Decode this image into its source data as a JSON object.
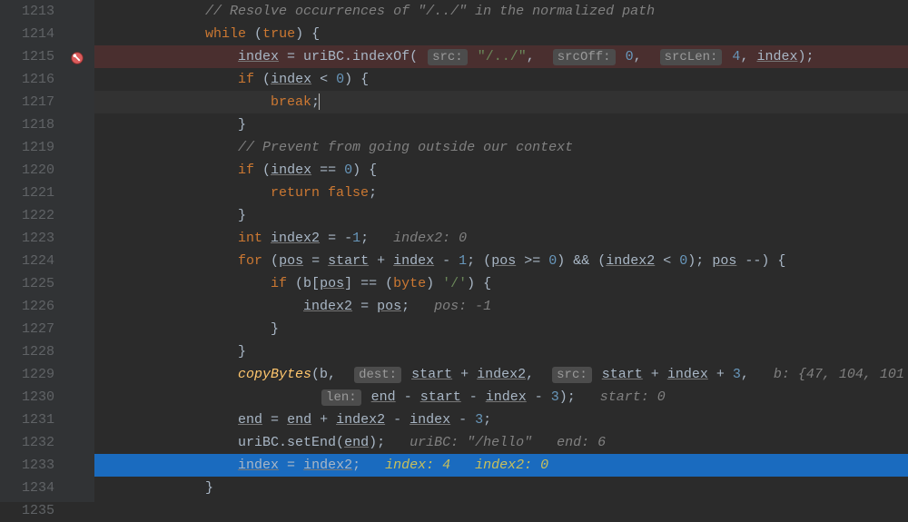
{
  "lineStart": 1213,
  "lines": [
    {
      "num": "1213",
      "cls": "",
      "indent": "            ",
      "tokens": [
        {
          "t": "// Resolve occurrences of \"/../\" in the normalized path",
          "c": "cmt"
        }
      ]
    },
    {
      "num": "1214",
      "cls": "",
      "indent": "            ",
      "tokens": [
        {
          "t": "while",
          "c": "kw"
        },
        {
          "t": " ("
        },
        {
          "t": "true",
          "c": "kw"
        },
        {
          "t": ") {"
        }
      ]
    },
    {
      "num": "1215",
      "cls": "hl-red",
      "indent": "                ",
      "tokens": [
        {
          "t": "index",
          "c": "var"
        },
        {
          "t": " = uriBC.indexOf( "
        },
        {
          "t": "src:",
          "c": "hint-box"
        },
        {
          "t": " "
        },
        {
          "t": "\"/../\"",
          "c": "str"
        },
        {
          "t": ",  "
        },
        {
          "t": "srcOff:",
          "c": "hint-box"
        },
        {
          "t": " "
        },
        {
          "t": "0",
          "c": "num"
        },
        {
          "t": ",  "
        },
        {
          "t": "srcLen:",
          "c": "hint-box"
        },
        {
          "t": " "
        },
        {
          "t": "4",
          "c": "num"
        },
        {
          "t": ", "
        },
        {
          "t": "index",
          "c": "var"
        },
        {
          "t": ");"
        }
      ]
    },
    {
      "num": "1216",
      "cls": "",
      "indent": "                ",
      "tokens": [
        {
          "t": "if",
          "c": "kw"
        },
        {
          "t": " ("
        },
        {
          "t": "index",
          "c": "var"
        },
        {
          "t": " < "
        },
        {
          "t": "0",
          "c": "num"
        },
        {
          "t": ") {"
        }
      ]
    },
    {
      "num": "1217",
      "cls": "hl-dark",
      "indent": "                    ",
      "tokens": [
        {
          "t": "break",
          "c": "kw"
        },
        {
          "t": ";"
        },
        {
          "t": "",
          "caret": true
        }
      ]
    },
    {
      "num": "1218",
      "cls": "",
      "indent": "                ",
      "tokens": [
        {
          "t": "}"
        }
      ]
    },
    {
      "num": "1219",
      "cls": "",
      "indent": "                ",
      "tokens": [
        {
          "t": "// Prevent from going outside our context",
          "c": "cmt"
        }
      ]
    },
    {
      "num": "1220",
      "cls": "",
      "indent": "                ",
      "tokens": [
        {
          "t": "if",
          "c": "kw"
        },
        {
          "t": " ("
        },
        {
          "t": "index",
          "c": "var"
        },
        {
          "t": " == "
        },
        {
          "t": "0",
          "c": "num"
        },
        {
          "t": ") {"
        }
      ]
    },
    {
      "num": "1221",
      "cls": "",
      "indent": "                    ",
      "tokens": [
        {
          "t": "return false",
          "c": "kw"
        },
        {
          "t": ";"
        }
      ]
    },
    {
      "num": "1222",
      "cls": "",
      "indent": "                ",
      "tokens": [
        {
          "t": "}"
        }
      ]
    },
    {
      "num": "1223",
      "cls": "",
      "indent": "                ",
      "tokens": [
        {
          "t": "int ",
          "c": "kw"
        },
        {
          "t": "index2",
          "c": "var"
        },
        {
          "t": " = -"
        },
        {
          "t": "1",
          "c": "num"
        },
        {
          "t": ";   "
        },
        {
          "t": "index2: 0",
          "c": "hint"
        }
      ]
    },
    {
      "num": "1224",
      "cls": "",
      "indent": "                ",
      "tokens": [
        {
          "t": "for",
          "c": "kw"
        },
        {
          "t": " ("
        },
        {
          "t": "pos",
          "c": "var"
        },
        {
          "t": " = "
        },
        {
          "t": "start",
          "c": "var"
        },
        {
          "t": " + "
        },
        {
          "t": "index",
          "c": "var"
        },
        {
          "t": " - "
        },
        {
          "t": "1",
          "c": "num"
        },
        {
          "t": "; ("
        },
        {
          "t": "pos",
          "c": "var"
        },
        {
          "t": " >= "
        },
        {
          "t": "0",
          "c": "num"
        },
        {
          "t": ") && ("
        },
        {
          "t": "index2",
          "c": "var"
        },
        {
          "t": " < "
        },
        {
          "t": "0",
          "c": "num"
        },
        {
          "t": "); "
        },
        {
          "t": "pos",
          "c": "var"
        },
        {
          "t": " --) {"
        }
      ]
    },
    {
      "num": "1225",
      "cls": "",
      "indent": "                    ",
      "tokens": [
        {
          "t": "if",
          "c": "kw"
        },
        {
          "t": " (b["
        },
        {
          "t": "pos",
          "c": "var"
        },
        {
          "t": "] == ("
        },
        {
          "t": "byte",
          "c": "kw"
        },
        {
          "t": ") "
        },
        {
          "t": "'/'",
          "c": "str"
        },
        {
          "t": ") {"
        }
      ]
    },
    {
      "num": "1226",
      "cls": "",
      "indent": "                        ",
      "tokens": [
        {
          "t": "index2",
          "c": "var"
        },
        {
          "t": " = "
        },
        {
          "t": "pos",
          "c": "var"
        },
        {
          "t": ";   "
        },
        {
          "t": "pos: -1",
          "c": "hint"
        }
      ]
    },
    {
      "num": "1227",
      "cls": "",
      "indent": "                    ",
      "tokens": [
        {
          "t": "}"
        }
      ]
    },
    {
      "num": "1228",
      "cls": "",
      "indent": "                ",
      "tokens": [
        {
          "t": "}"
        }
      ]
    },
    {
      "num": "1229",
      "cls": "",
      "indent": "                ",
      "tokens": [
        {
          "t": "copyBytes",
          "c": "fn"
        },
        {
          "t": "(b,  "
        },
        {
          "t": "dest:",
          "c": "hint-box"
        },
        {
          "t": " "
        },
        {
          "t": "start",
          "c": "var"
        },
        {
          "t": " + "
        },
        {
          "t": "index2",
          "c": "var"
        },
        {
          "t": ",  "
        },
        {
          "t": "src:",
          "c": "hint-box"
        },
        {
          "t": " "
        },
        {
          "t": "start",
          "c": "var"
        },
        {
          "t": " + "
        },
        {
          "t": "index",
          "c": "var"
        },
        {
          "t": " + "
        },
        {
          "t": "3",
          "c": "num"
        },
        {
          "t": ",   "
        },
        {
          "t": "b: {47, 104, 101",
          "c": "hint"
        }
      ]
    },
    {
      "num": "1230",
      "cls": "",
      "indent": "                          ",
      "tokens": [
        {
          "t": "len:",
          "c": "hint-box"
        },
        {
          "t": " "
        },
        {
          "t": "end",
          "c": "var"
        },
        {
          "t": " - "
        },
        {
          "t": "start",
          "c": "var"
        },
        {
          "t": " - "
        },
        {
          "t": "index",
          "c": "var"
        },
        {
          "t": " - "
        },
        {
          "t": "3",
          "c": "num"
        },
        {
          "t": ");   "
        },
        {
          "t": "start: 0",
          "c": "hint"
        }
      ]
    },
    {
      "num": "1231",
      "cls": "",
      "indent": "                ",
      "tokens": [
        {
          "t": "end",
          "c": "var"
        },
        {
          "t": " = "
        },
        {
          "t": "end",
          "c": "var"
        },
        {
          "t": " + "
        },
        {
          "t": "index2",
          "c": "var"
        },
        {
          "t": " - "
        },
        {
          "t": "index",
          "c": "var"
        },
        {
          "t": " - "
        },
        {
          "t": "3",
          "c": "num"
        },
        {
          "t": ";"
        }
      ]
    },
    {
      "num": "1232",
      "cls": "",
      "indent": "                ",
      "tokens": [
        {
          "t": "uriBC.setEnd("
        },
        {
          "t": "end",
          "c": "var"
        },
        {
          "t": ");   "
        },
        {
          "t": "uriBC: \"/hello\"   end: 6",
          "c": "hint"
        }
      ]
    },
    {
      "num": "1233",
      "cls": "hl-blue",
      "indent": "                ",
      "tokens": [
        {
          "t": "index",
          "c": "var"
        },
        {
          "t": " = "
        },
        {
          "t": "index2",
          "c": "var"
        },
        {
          "t": ";   "
        },
        {
          "t": "index: 4   index2: 0",
          "c": "hint-y"
        }
      ]
    },
    {
      "num": "1234",
      "cls": "",
      "indent": "            ",
      "tokens": [
        {
          "t": "}"
        }
      ]
    },
    {
      "num": "1235",
      "cls": "",
      "indent": "",
      "tokens": []
    }
  ],
  "breakpointLine": 1215
}
